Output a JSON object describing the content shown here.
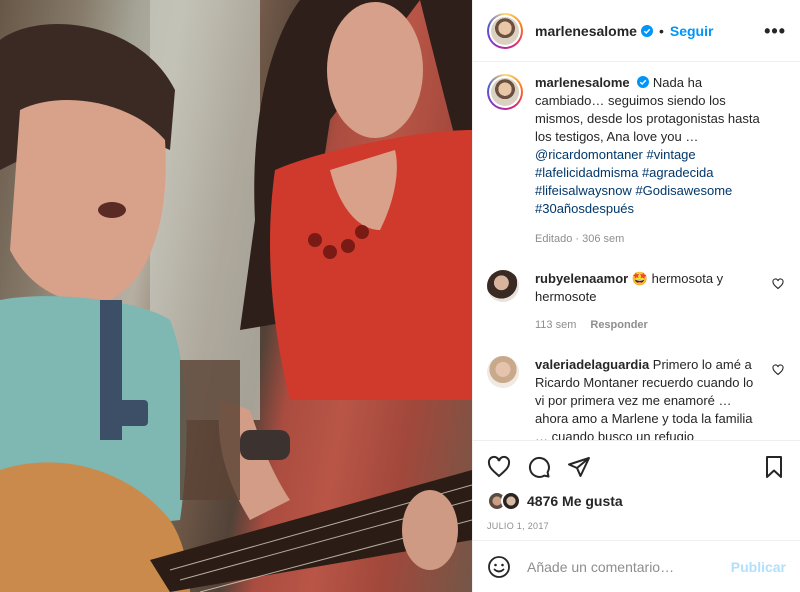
{
  "post": {
    "username": "marlenesalome",
    "follow_label": "Seguir",
    "dot": "•",
    "more_label": "•••"
  },
  "caption": {
    "username": "marlenesalome",
    "text": "Nada ha cambiado… seguimos siendo los mismos, desde los protagonistas hasta los testigos, Ana love you …",
    "mention": "@ricardomontaner",
    "hashtags": [
      "#vintage",
      "#lafelicidadmisma",
      "#agradecida",
      "#lifeisalwaysnow",
      "#Godisawesome",
      "#30añosdespués"
    ],
    "meta": "Editado · 306 sem"
  },
  "comments": [
    {
      "username": "rubyelenaamor",
      "text": "🤩 hermosota y hermosote",
      "time": "113 sem",
      "reply_label": "Responder"
    },
    {
      "username": "valeriadelaguardia",
      "text": "Primero lo amé a Ricardo Montaner recuerdo cuando lo vi por primera vez me enamoré … ahora amo a Marlene y toda la familia … cuando busco un refugio",
      "time": "",
      "reply_label": ""
    }
  ],
  "actions": {
    "likes": "4876 Me gusta",
    "date": "JULIO 1, 2017"
  },
  "add_comment": {
    "placeholder": "Añade un comentario…",
    "publish_label": "Publicar"
  },
  "colors": {
    "accent": "#0095f6",
    "hashtag": "#00376b",
    "muted": "#8e8e8e",
    "publish_disabled": "#b2dffc"
  }
}
